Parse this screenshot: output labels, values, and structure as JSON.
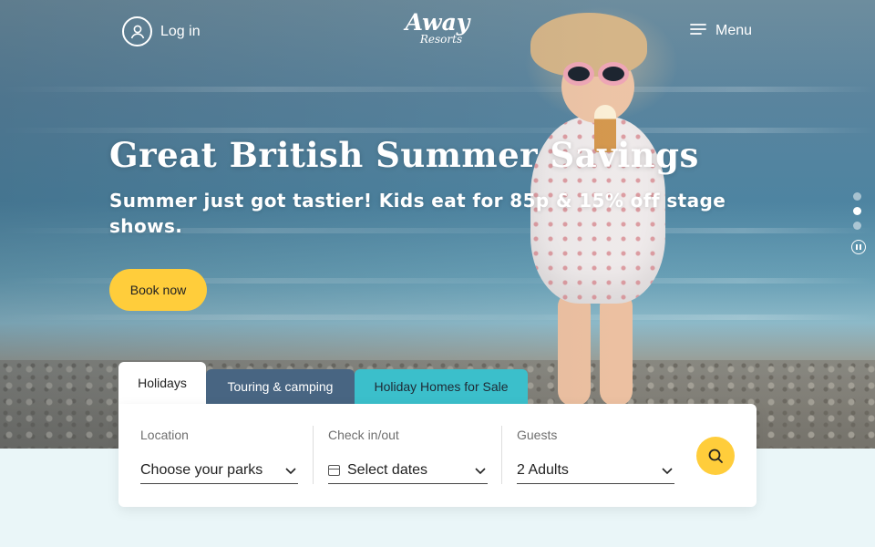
{
  "header": {
    "login_label": "Log in",
    "logo_line1": "Away",
    "logo_line2": "Resorts",
    "menu_label": "Menu"
  },
  "hero": {
    "headline": "Great British Summer Savings",
    "subtitle": "Summer just got tastier! Kids eat for 85p & 15% off stage shows.",
    "cta_label": "Book now",
    "slides": {
      "count": 3,
      "active_index": 1
    }
  },
  "search": {
    "tabs": [
      {
        "label": "Holidays",
        "active": true
      },
      {
        "label": "Touring & camping",
        "active": false
      },
      {
        "label": "Holiday Homes for Sale",
        "active": false
      }
    ],
    "location": {
      "label": "Location",
      "value": "Choose your parks"
    },
    "dates": {
      "label": "Check in/out",
      "value": "Select dates"
    },
    "guests": {
      "label": "Guests",
      "value": "2 Adults"
    }
  },
  "colors": {
    "accent_yellow": "#ffcd3b",
    "tab_touring": "#486582",
    "tab_homes": "#3bbfcb",
    "page_background": "#eaf6f8"
  },
  "icons": {
    "login": "user-circle-icon",
    "menu": "hamburger-menu-icon",
    "chevron": "chevron-down-icon",
    "calendar": "calendar-icon",
    "search": "search-icon",
    "pause": "pause-icon"
  }
}
